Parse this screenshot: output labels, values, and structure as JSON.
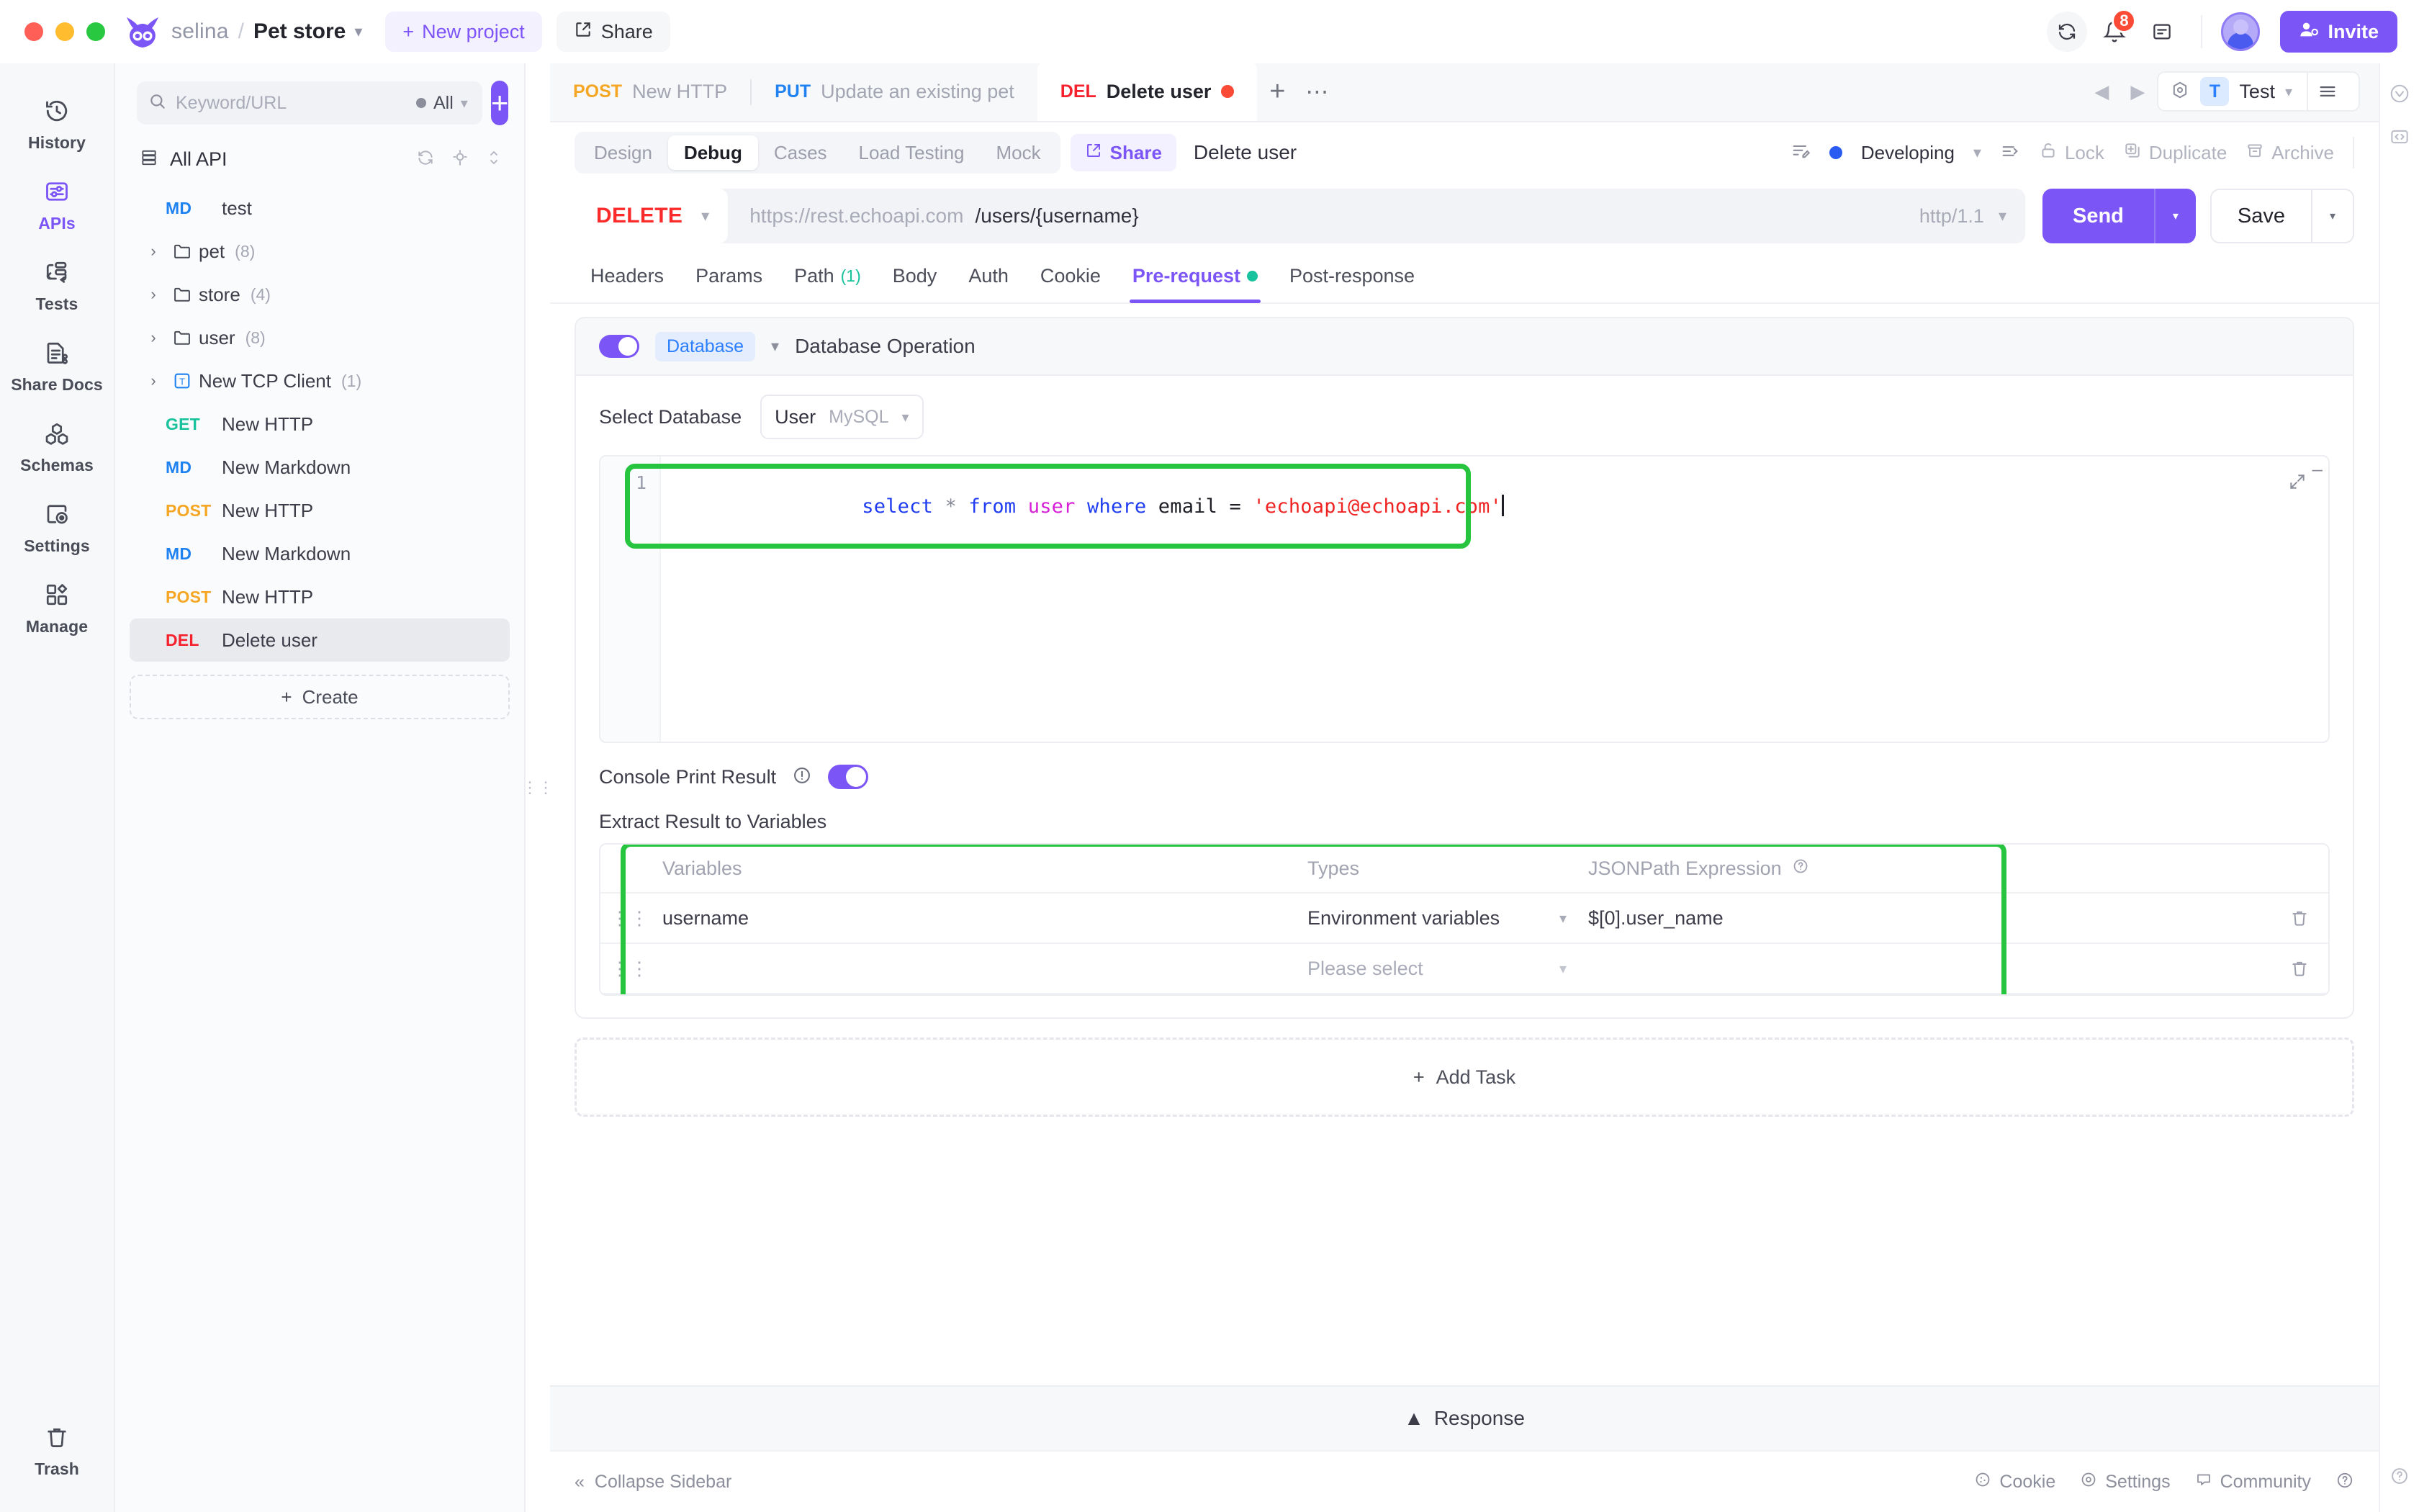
{
  "titlebar": {
    "user": "selina",
    "separator": "/",
    "project": "Pet store",
    "new_project": "New project",
    "share": "Share",
    "notification_count": "8",
    "invite": "Invite"
  },
  "rail": {
    "items": [
      {
        "label": "History",
        "icon": "history-icon",
        "active": false
      },
      {
        "label": "APIs",
        "icon": "apis-icon",
        "active": true
      },
      {
        "label": "Tests",
        "icon": "tests-icon",
        "active": false
      },
      {
        "label": "Share Docs",
        "icon": "share-docs-icon",
        "active": false
      },
      {
        "label": "Schemas",
        "icon": "schemas-icon",
        "active": false
      },
      {
        "label": "Settings",
        "icon": "settings-icon",
        "active": false
      },
      {
        "label": "Manage",
        "icon": "manage-icon",
        "active": false
      }
    ],
    "trash": "Trash"
  },
  "tree": {
    "search_placeholder": "Keyword/URL",
    "search_value": "",
    "filter": "All",
    "add_label": "+",
    "root": "All API",
    "nodes": [
      {
        "kind": "file",
        "method": "MD",
        "name": "test",
        "count": ""
      },
      {
        "kind": "folder",
        "method": "",
        "name": "pet",
        "count": "(8)"
      },
      {
        "kind": "folder",
        "method": "",
        "name": "store",
        "count": "(4)"
      },
      {
        "kind": "folder",
        "method": "",
        "name": "user",
        "count": "(8)"
      },
      {
        "kind": "tcp",
        "method": "",
        "name": "New TCP Client",
        "count": "(1)"
      },
      {
        "kind": "file",
        "method": "GET",
        "name": "New HTTP",
        "count": ""
      },
      {
        "kind": "file",
        "method": "MD",
        "name": "New Markdown",
        "count": ""
      },
      {
        "kind": "file",
        "method": "POST",
        "name": "New HTTP",
        "count": ""
      },
      {
        "kind": "file",
        "method": "MD",
        "name": "New Markdown",
        "count": ""
      },
      {
        "kind": "file",
        "method": "POST",
        "name": "New HTTP",
        "count": ""
      },
      {
        "kind": "file",
        "method": "DEL",
        "name": "Delete user",
        "count": "",
        "selected": true
      }
    ],
    "create": "Create"
  },
  "tabstrip": {
    "tabs": [
      {
        "method": "POST",
        "label": "New HTTP",
        "active": false,
        "dirty": false
      },
      {
        "method": "PUT",
        "label": "Update an existing pet",
        "active": false,
        "dirty": false
      },
      {
        "method": "DEL",
        "label": "Delete user",
        "active": true,
        "dirty": true
      }
    ],
    "env_letter": "T",
    "env_name": "Test"
  },
  "subbar": {
    "segments": [
      {
        "label": "Design",
        "active": false
      },
      {
        "label": "Debug",
        "active": true
      },
      {
        "label": "Cases",
        "active": false
      },
      {
        "label": "Load Testing",
        "active": false
      },
      {
        "label": "Mock",
        "active": false
      }
    ],
    "share": "Share",
    "request_title": "Delete user",
    "status": "Developing",
    "lock": "Lock",
    "duplicate": "Duplicate",
    "archive": "Archive"
  },
  "urlbar": {
    "method": "DELETE",
    "host": "https://rest.echoapi.com",
    "path": "/users/{username}",
    "protocol": "http/1.1",
    "send": "Send",
    "save": "Save"
  },
  "request_tabs": [
    {
      "label": "Headers",
      "count": "",
      "active": false,
      "dot": false
    },
    {
      "label": "Params",
      "count": "",
      "active": false,
      "dot": false
    },
    {
      "label": "Path",
      "count": "(1)",
      "active": false,
      "dot": false
    },
    {
      "label": "Body",
      "count": "",
      "active": false,
      "dot": false
    },
    {
      "label": "Auth",
      "count": "",
      "active": false,
      "dot": false
    },
    {
      "label": "Cookie",
      "count": "",
      "active": false,
      "dot": false
    },
    {
      "label": "Pre-request",
      "count": "",
      "active": true,
      "dot": true
    },
    {
      "label": "Post-response",
      "count": "",
      "active": false,
      "dot": false
    }
  ],
  "task": {
    "type_chip": "Database",
    "title": "Database Operation",
    "select_db_label": "Select Database",
    "db_name": "User",
    "db_kind": "MySQL",
    "line_number": "1",
    "sql": {
      "tokens": [
        {
          "t": "select",
          "c": "k-blue"
        },
        {
          "t": " ",
          "c": "k-dark"
        },
        {
          "t": "*",
          "c": "k-star"
        },
        {
          "t": " ",
          "c": "k-dark"
        },
        {
          "t": "from",
          "c": "k-blue"
        },
        {
          "t": " ",
          "c": "k-dark"
        },
        {
          "t": "user",
          "c": "k-mag"
        },
        {
          "t": " ",
          "c": "k-dark"
        },
        {
          "t": "where",
          "c": "k-blue"
        },
        {
          "t": " ",
          "c": "k-dark"
        },
        {
          "t": "email",
          "c": "k-dark"
        },
        {
          "t": " = ",
          "c": "k-dark"
        },
        {
          "t": "'echoapi@echoapi.com'",
          "c": "k-red"
        }
      ],
      "plain": "select * from user where email = 'echoapi@echoapi.com'"
    },
    "console_print_label": "Console Print Result",
    "extract_label": "Extract Result to Variables",
    "table": {
      "headers": [
        "Variables",
        "Types",
        "JSONPath Expression"
      ],
      "rows": [
        {
          "variable": "username",
          "type": "Environment variables",
          "jsonpath": "$[0].user_name"
        },
        {
          "variable": "",
          "type": "Please select",
          "jsonpath": "",
          "placeholder": true
        }
      ]
    },
    "add_task": "Add Task"
  },
  "response_bar": "Response",
  "footer": {
    "collapse": "Collapse Sidebar",
    "items": [
      "Cookie",
      "Settings",
      "Community"
    ]
  },
  "colors": {
    "accent": "#7b55f6",
    "highlight": "#27c53f",
    "delete": "#fb2b2b",
    "get": "#18c29c",
    "post": "#f5a623",
    "md": "#1f82f0"
  }
}
